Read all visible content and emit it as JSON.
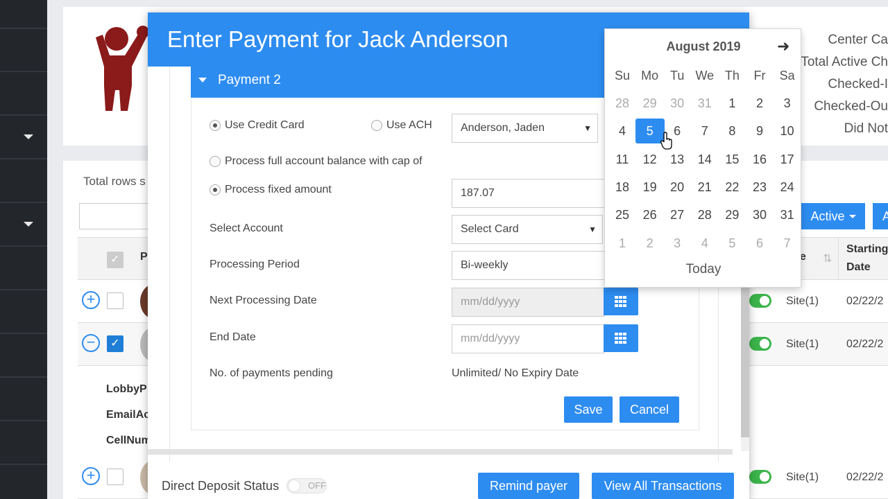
{
  "background": {
    "stats": [
      "Center Ca",
      "Total Active Ch",
      "Checked-I",
      "Checked-Ou",
      "Did Not"
    ],
    "total_rows_label": "Total rows s",
    "active_button": "Active",
    "a_button": "A",
    "table": {
      "col_p": "P",
      "col_e": "e",
      "col_starting": "Starting",
      "col_date": "Date"
    },
    "rows": [
      {
        "site": "Site(1)",
        "date": "02/22/2"
      },
      {
        "site": "Site(1)",
        "date": "02/22/2"
      },
      {
        "site": "Site(1)",
        "date": "02/22/2"
      }
    ],
    "details": [
      "LobbyP",
      "EmailAc",
      "CellNum"
    ]
  },
  "modal": {
    "title": "Enter Payment for Jack Anderson",
    "panel_title": "Payment 2",
    "use_credit_card": "Use Credit Card",
    "use_ach": "Use ACH",
    "payer_select": "Anderson, Jaden",
    "process_full_balance": "Process full account balance with cap of",
    "process_fixed_amount": "Process fixed amount",
    "fixed_amount_value": "187.07",
    "select_account_label": "Select Account",
    "select_account_value": "Select Card",
    "processing_period_label": "Processing Period",
    "processing_period_value": "Bi-weekly",
    "next_processing_date_label": "Next Processing Date",
    "next_processing_date_placeholder": "mm/dd/yyyy",
    "end_date_label": "End Date",
    "end_date_placeholder": "mm/dd/yyyy",
    "payments_pending_label": "No. of payments pending",
    "payments_pending_value": "Unlimited/ No Expiry Date",
    "save": "Save",
    "cancel": "Cancel",
    "direct_deposit_label": "Direct Deposit Status",
    "direct_deposit_toggle": "OFF",
    "remind_payer": "Remind payer",
    "view_all_transactions": "View All Transactions"
  },
  "datepicker": {
    "month": "August 2019",
    "next_icon": "arrow-right-icon",
    "weekdays": [
      "Su",
      "Mo",
      "Tu",
      "We",
      "Th",
      "Fr",
      "Sa"
    ],
    "weeks": [
      [
        "28",
        "29",
        "30",
        "31",
        "1",
        "2",
        "3"
      ],
      [
        "4",
        "5",
        "6",
        "7",
        "8",
        "9",
        "10"
      ],
      [
        "11",
        "12",
        "13",
        "14",
        "15",
        "16",
        "17"
      ],
      [
        "18",
        "19",
        "20",
        "21",
        "22",
        "23",
        "24"
      ],
      [
        "25",
        "26",
        "27",
        "28",
        "29",
        "30",
        "31"
      ],
      [
        "1",
        "2",
        "3",
        "4",
        "5",
        "6",
        "7"
      ]
    ],
    "selected": "5",
    "today": "Today"
  },
  "colors": {
    "accent": "#2d8cf0",
    "sidebar": "#23262b",
    "toggle_on": "#3cb44b",
    "logo": "#8b1a1a"
  }
}
